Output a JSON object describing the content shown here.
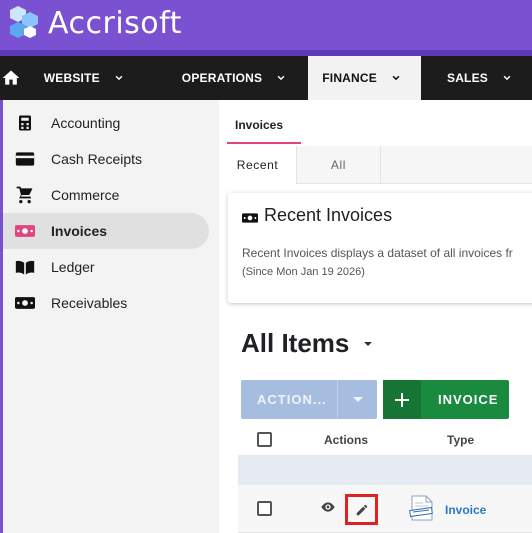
{
  "brand": {
    "name": "Accrisoft",
    "color": "#7a52d1"
  },
  "topnav": {
    "items": [
      {
        "label": "WEBSITE",
        "active": false
      },
      {
        "label": "OPERATIONS",
        "active": false
      },
      {
        "label": "FINANCE",
        "active": true
      },
      {
        "label": "SALES",
        "active": false
      }
    ]
  },
  "sidebar": {
    "items": [
      {
        "label": "Accounting",
        "icon": "calculator-icon"
      },
      {
        "label": "Cash Receipts",
        "icon": "credit-card-icon"
      },
      {
        "label": "Commerce",
        "icon": "shopping-cart-icon"
      },
      {
        "label": "Invoices",
        "icon": "money-icon",
        "active": true
      },
      {
        "label": "Ledger",
        "icon": "book-icon"
      },
      {
        "label": "Receivables",
        "icon": "money-icon"
      }
    ]
  },
  "main": {
    "breadcrumb": "Invoices",
    "subtabs": {
      "recent": "Recent",
      "all": "All"
    },
    "card": {
      "title": "Recent Invoices",
      "description": "Recent Invoices displays a dataset of all invoices fr",
      "since": "(Since Mon Jan 19 2026)"
    },
    "list_title": "All Items",
    "actions": {
      "action_label": "ACTION...",
      "invoice_label": "INVOICE"
    },
    "table": {
      "headers": {
        "actions": "Actions",
        "type": "Type"
      },
      "rows": [
        {
          "type": "Invoice"
        }
      ]
    }
  },
  "colors": {
    "accent_pink": "#e0457f",
    "invoice_green": "#1a8a3e",
    "action_blue": "#a7bddf",
    "highlight_red": "#e02121",
    "link_blue": "#2a78c8"
  }
}
